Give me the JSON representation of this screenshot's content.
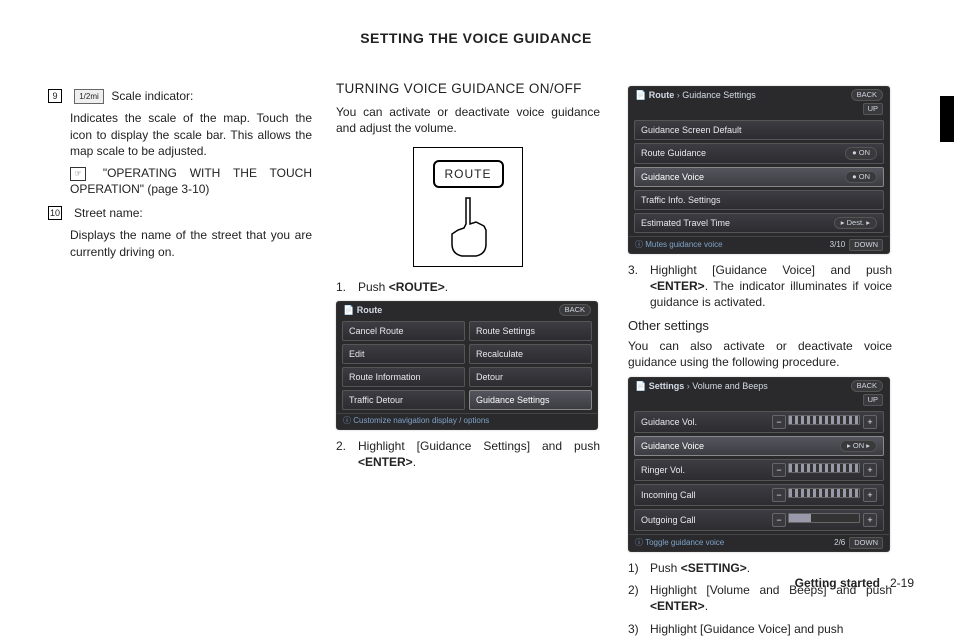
{
  "title": "SETTING THE VOICE GUIDANCE",
  "col1": {
    "item9": {
      "num": "9",
      "icon_text": "1/2mi",
      "label": "Scale indicator:",
      "body": "Indicates the scale of the map. Touch the icon to display the scale bar. This allows the map scale to be adjusted.",
      "ref": "\"OPERATING WITH THE TOUCH OPERATION\" (page 3-10)"
    },
    "item10": {
      "num": "10",
      "label": "Street name:",
      "body": "Displays the name of the street that you are currently driving on."
    }
  },
  "col2": {
    "subhead": "TURNING VOICE GUIDANCE ON/OFF",
    "intro": "You can activate or deactivate voice guidance and adjust the volume.",
    "route_btn": "ROUTE",
    "step1": {
      "n": "1.",
      "t1": "Push ",
      "b": "<ROUTE>",
      "t2": "."
    },
    "screen1": {
      "crumb": "Route",
      "back": "BACK",
      "buttons": [
        "Cancel Route",
        "Route Settings",
        "Edit",
        "Recalculate",
        "Route Information",
        "Detour",
        "Traffic Detour",
        "Guidance Settings"
      ],
      "hl_index": 7,
      "footer": "Customize navigation display / options"
    },
    "step2": {
      "n": "2.",
      "t1": "Highlight [Guidance Settings] and push ",
      "b": "<ENTER>",
      "t2": "."
    }
  },
  "col3": {
    "screen2": {
      "crumb1": "Route",
      "crumb2": "Guidance Settings",
      "back": "BACK",
      "up": "UP",
      "rows": [
        {
          "label": "Guidance Screen Default",
          "right": ""
        },
        {
          "label": "Route Guidance",
          "right": "ON"
        },
        {
          "label": "Guidance Voice",
          "right": "ON",
          "hl": true
        },
        {
          "label": "Traffic Info. Settings",
          "right": ""
        },
        {
          "label": "Estimated Travel Time",
          "right": "Dest."
        }
      ],
      "page": "3/10",
      "down": "DOWN",
      "footer": "Mutes guidance voice"
    },
    "step3": {
      "n": "3.",
      "t1": "Highlight [Guidance Voice] and push ",
      "b": "<ENTER>",
      "t2": ". The indicator illuminates if voice guidance is activated."
    },
    "other_head": "Other settings",
    "other_intro": "You can also activate or deactivate voice guidance using the following procedure.",
    "screen3": {
      "crumb1": "Settings",
      "crumb2": "Volume and Beeps",
      "back": "BACK",
      "up": "UP",
      "rows": [
        {
          "label": "Guidance Vol.",
          "type": "slider_full"
        },
        {
          "label": "Guidance Voice",
          "type": "on",
          "hl": true,
          "on": "ON"
        },
        {
          "label": "Ringer Vol.",
          "type": "slider_full"
        },
        {
          "label": "Incoming Call",
          "type": "slider_full"
        },
        {
          "label": "Outgoing Call",
          "type": "slider_half"
        }
      ],
      "page": "2/6",
      "down": "DOWN",
      "footer": "Toggle guidance voice"
    },
    "os1": {
      "n": "1)",
      "t1": "Push ",
      "b": "<SETTING>",
      "t2": "."
    },
    "os2": {
      "n": "2)",
      "t1": "Highlight [Volume and Beeps] and push ",
      "b": "<ENTER>",
      "t2": "."
    },
    "os3": {
      "n": "3)",
      "t": "Highlight [Guidance Voice] and push"
    }
  },
  "footer": {
    "section": "Getting started",
    "page": "2-19"
  }
}
